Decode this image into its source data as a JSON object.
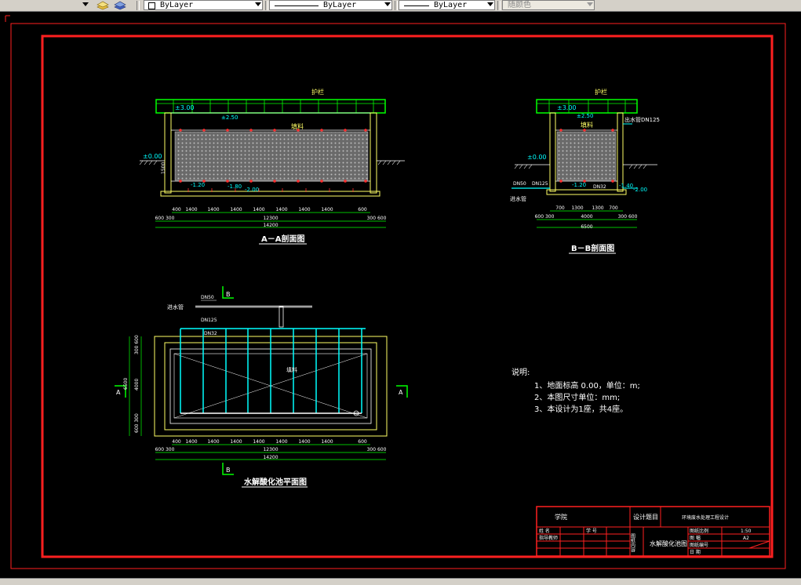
{
  "toolbar": {
    "color_combo": "ByLayer",
    "linetype_combo": "ByLayer",
    "lineweight_combo": "ByLayer",
    "plotstyle_combo": "随颜色"
  },
  "drawing": {
    "section_aa": {
      "title": "A－A剖面图",
      "label_top": "护栏",
      "label_fill": "填料",
      "elev_top": "±3.00",
      "elev_water": "±2.50",
      "elev_ground": "±0.00",
      "elev_low1": "-1.20",
      "elev_low2": "-1.80",
      "elev_low3": "-2.00",
      "dim_depth": "1500",
      "dims_row1": [
        "400",
        "1400",
        "1400",
        "1400",
        "1400",
        "1400",
        "1400",
        "1400",
        "600"
      ],
      "dims_row2_left": "600 300",
      "dims_row2_mid": "12300",
      "dims_row2_right": "300 600",
      "dims_total": "14200"
    },
    "section_bb": {
      "title": "B－B剖面图",
      "label_top": "护栏",
      "label_fill": "填料",
      "label_pipe_out": "出水管DN125",
      "label_pipe_in1": "DN50",
      "label_pipe_in2": "DN125",
      "label_pipe_in3": "DN32",
      "label_inlet": "进水管",
      "elev_top": "±3.00",
      "elev_water": "±2.50",
      "elev_ground": "±0.00",
      "elev_low1": "-1.20",
      "elev_low2": "-1.40",
      "elev_low3": "-2.00",
      "dims_row1": [
        "700",
        "1300",
        "1300",
        "700"
      ],
      "dims_row2_left": "600 300",
      "dims_row2_mid": "4000",
      "dims_row2_right": "300 600",
      "dims_total": "6500"
    },
    "plan": {
      "title": "水解酸化池平面图",
      "label_inlet": "进水管",
      "label_dn50": "DN50",
      "label_dn125": "DN125",
      "label_dn32": "DN32",
      "label_fill": "填料",
      "marker_a": "A",
      "marker_b": "B",
      "dim_left1": "300 600",
      "dim_left2": "4000",
      "dim_left3": "600 300",
      "dim_left_total": "6500",
      "dims_row1": [
        "400",
        "1400",
        "1400",
        "1400",
        "1400",
        "1400",
        "1400",
        "1400",
        "600"
      ],
      "dims_row2_left": "600 300",
      "dims_row2_mid": "12300",
      "dims_row2_right": "300 600",
      "dims_total": "14200"
    },
    "notes": {
      "heading": "说明:",
      "items": [
        "1、地面标高 0.00，单位：m;",
        "2、本图尺寸单位：mm;",
        "3、本设计为1座，共4座。"
      ]
    },
    "title_block": {
      "school": "学院",
      "design_topic_label": "设计题目",
      "design_topic": "环境废水处理工程设计",
      "name_label": "姓 名",
      "advisor_label": "指导教师",
      "student_id_label": "学 号",
      "drawing_content_label": "图纸内容",
      "drawing_name": "水解酸化池图",
      "scale_label": "图纸比例",
      "scale_value": "1:50",
      "size_label": "图 幅",
      "size_value": "A2",
      "number_label": "图纸编号",
      "date_label": "日 期"
    }
  }
}
